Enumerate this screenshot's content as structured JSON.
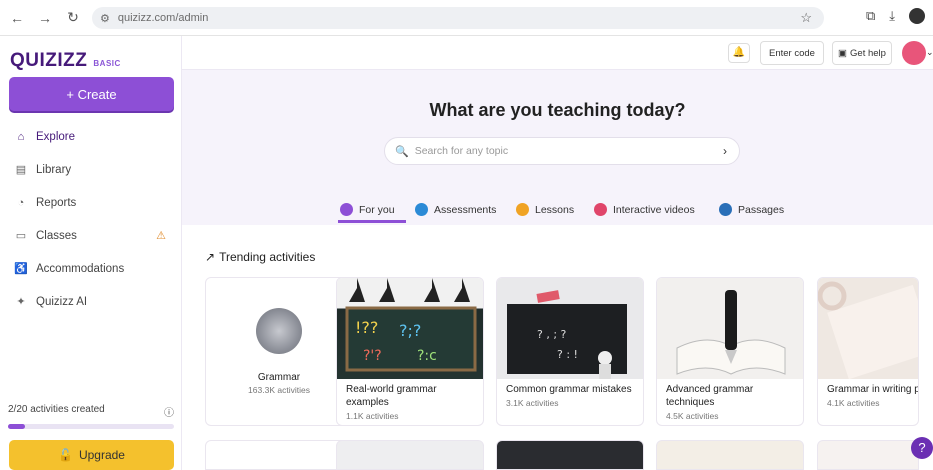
{
  "browser": {
    "url": "quizizz.com/admin"
  },
  "sidebar": {
    "logo": "QUIZIZZ",
    "plan_badge": "BASIC",
    "create_label": "+ Create",
    "items": [
      {
        "label": "Explore",
        "icon": "explore-icon"
      },
      {
        "label": "Library",
        "icon": "library-icon"
      },
      {
        "label": "Reports",
        "icon": "reports-icon"
      },
      {
        "label": "Classes",
        "icon": "classes-icon"
      },
      {
        "label": "Accommodations",
        "icon": "accommodations-icon"
      },
      {
        "label": "Quizizz AI",
        "icon": "ai-sparkle-icon"
      }
    ],
    "activities_created": "2/20 activities created",
    "activities_progress": 0.1,
    "upgrade_label": "Upgrade"
  },
  "topbar": {
    "enter_code": "Enter code",
    "get_help": "Get help"
  },
  "hero": {
    "title": "What are you teaching today?",
    "search_placeholder": "Search for any topic"
  },
  "tabs": [
    {
      "label": "For you",
      "color": "#8d4fd6"
    },
    {
      "label": "Assessments",
      "color": "#2b8ad6"
    },
    {
      "label": "Lessons",
      "color": "#f0a324"
    },
    {
      "label": "Interactive videos",
      "color": "#e0456a"
    },
    {
      "label": "Passages",
      "color": "#2a6fb8"
    }
  ],
  "trending": {
    "title": "Trending activities",
    "cards": [
      {
        "name": "Grammar",
        "count": "163.3K activities"
      },
      {
        "name": "Real-world grammar examples",
        "count": "1.1K activities"
      },
      {
        "name": "Common grammar mistakes",
        "count": "3.1K activities"
      },
      {
        "name": "Advanced grammar techniques",
        "count": "4.5K activities"
      },
      {
        "name": "Grammar in writing practice",
        "count": "4.1K activities"
      }
    ]
  }
}
